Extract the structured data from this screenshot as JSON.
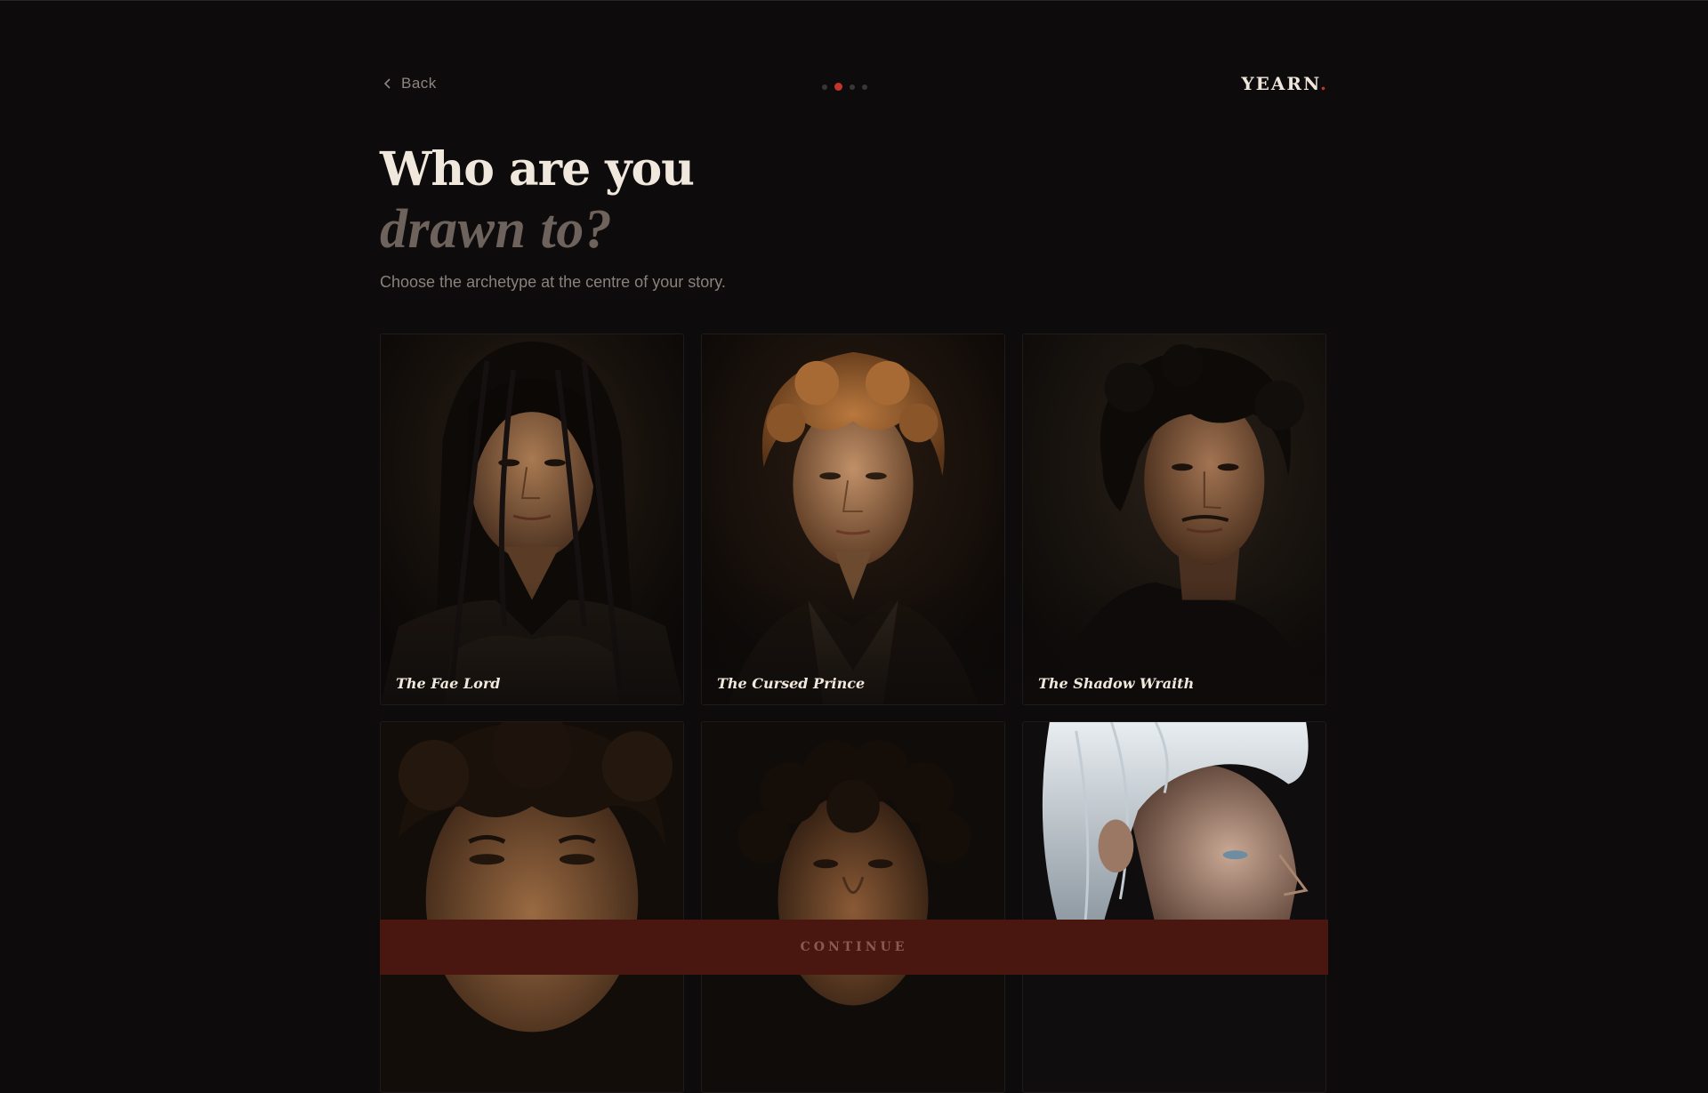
{
  "header": {
    "back_label": "Back",
    "logo_text": "YEARN",
    "logo_period": ".",
    "steps": {
      "total": 4,
      "current": 2
    }
  },
  "main": {
    "title_line1": "Who are you",
    "title_line2": "drawn to?",
    "subtitle": "Choose the archetype at the centre of your story."
  },
  "archetypes": [
    {
      "label": "The Fae Lord",
      "icon": "long-black-hair-portrait"
    },
    {
      "label": "The Cursed Prince",
      "icon": "golden-curly-hair-portrait"
    },
    {
      "label": "The Shadow Wraith",
      "icon": "dark-wavy-hair-portrait"
    },
    {
      "label": "",
      "icon": "messy-dark-hair-portrait"
    },
    {
      "label": "",
      "icon": "tight-curls-portrait"
    },
    {
      "label": "",
      "icon": "white-hair-profile-portrait"
    }
  ],
  "footer": {
    "continue_label": "CONTINUE"
  },
  "colors": {
    "background": "#0d0b0b",
    "accent": "#c1352d",
    "continue_bg": "#4a1710",
    "title": "#f1e8dd",
    "title_muted": "#6d625c"
  }
}
